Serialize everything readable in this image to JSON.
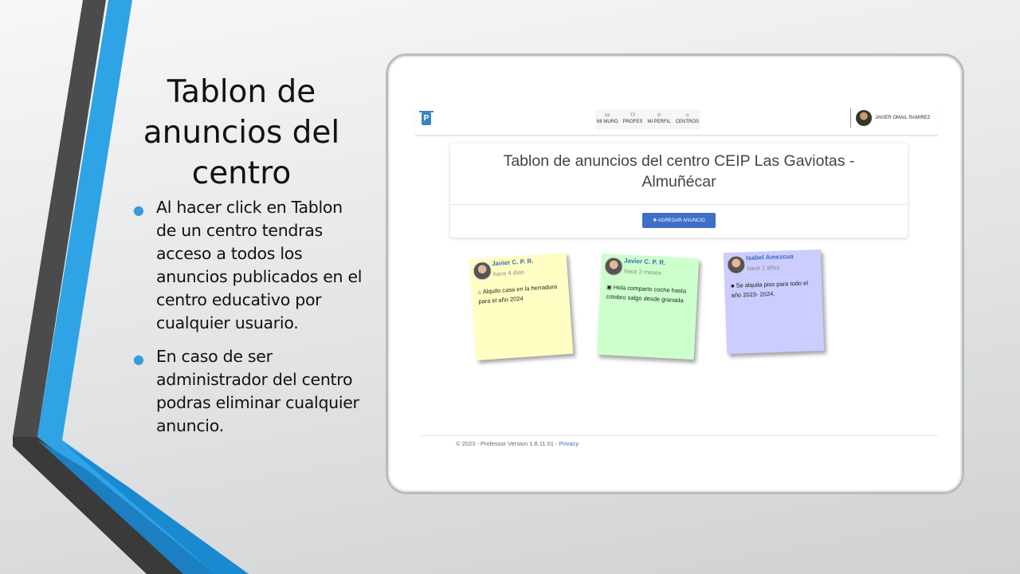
{
  "slide": {
    "title": "Tablon de anuncios del centro",
    "bullets": [
      "Al hacer click en Tablon de un centro tendras acceso a todos los anuncios publicados en el centro educativo por cualquier usuario.",
      "En caso de ser administrador del centro podras eliminar cualquier anuncio."
    ]
  },
  "app": {
    "logo_letter": "P",
    "nav": [
      {
        "label": "MI MURO",
        "icon": "laptop-icon"
      },
      {
        "label": "PROFES",
        "icon": "users-icon"
      },
      {
        "label": "MI PERFIL",
        "icon": "user-icon"
      },
      {
        "label": "CENTROS",
        "icon": "building-icon"
      }
    ],
    "user_name": "JAVIER OMAIL RAMIREZ",
    "board_title": "Tablon de anuncios del centro CEIP Las Gaviotas - Almuñécar",
    "add_button": "✚ AGREGAR ANUNCIO",
    "notes": [
      {
        "author": "Javier C. P. R.",
        "time": "hace 4 días",
        "icon": "home-icon",
        "text": "Alquilo casa en la herradura para el año 2024",
        "color": "#ffffc4"
      },
      {
        "author": "Javier C. P. R.",
        "time": "hace 2 meses",
        "icon": "car-icon",
        "text": "Hola comparto coche hasta cotobro salgo desde granada",
        "color": "#ccffcc"
      },
      {
        "author": "Isabel Amezcua",
        "time": "hace 1 años",
        "icon": "square-icon",
        "text": "Se alquila piso para todo el año 2023- 2024.",
        "color": "#ccccff"
      }
    ],
    "footer": {
      "text": "© 2023 - Professor Version 1.8.11.01 - ",
      "link": "Privacy"
    }
  },
  "colors": {
    "accent_blue": "#2ea3e6",
    "dark_gray": "#4a4a4a",
    "button_blue": "#3f6fc6"
  }
}
